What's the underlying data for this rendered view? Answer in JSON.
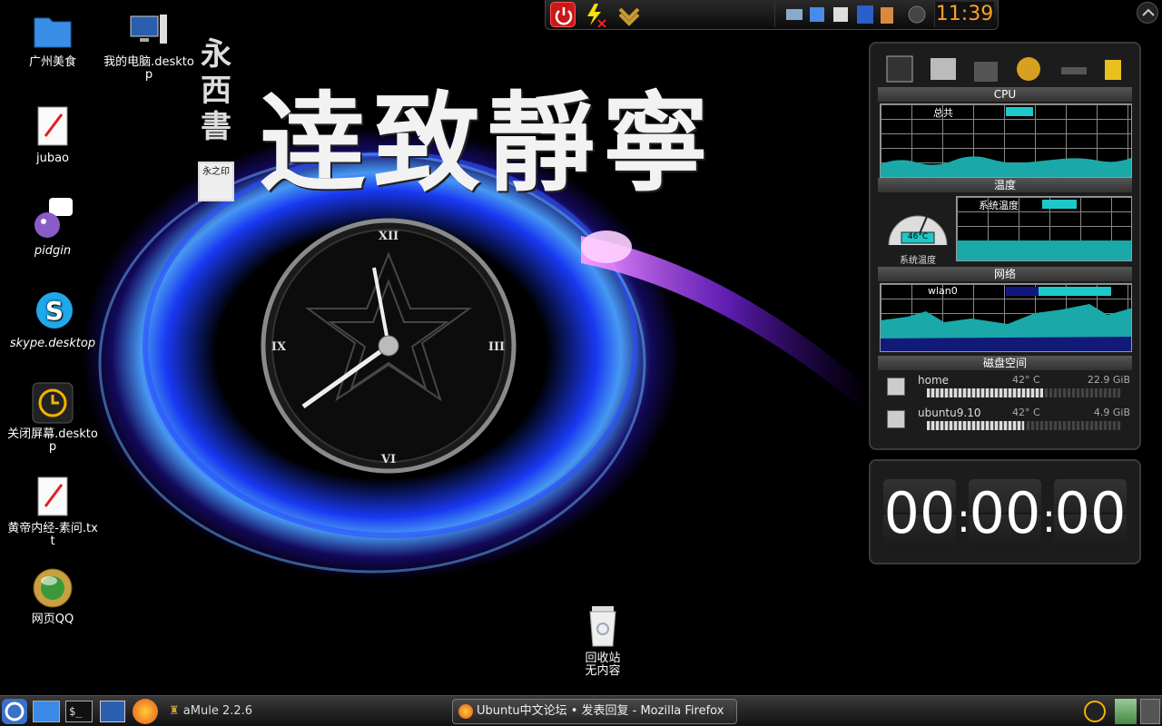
{
  "wallpaper": {
    "calligraphy": "逹致靜寧",
    "side_text": "永西書",
    "seal_text": "永之印"
  },
  "desktop_icons": [
    {
      "label": "广州美食",
      "italic": false
    },
    {
      "label": "我的电脑.desktop",
      "italic": false
    },
    {
      "label": "jubao",
      "italic": false
    },
    {
      "label": "pidgin",
      "italic": true
    },
    {
      "label": "skype.desktop",
      "italic": true
    },
    {
      "label": "关闭屏幕.desktop",
      "italic": false
    },
    {
      "label": "黄帝内经-素问.txt",
      "italic": false
    },
    {
      "label": "网页QQ",
      "italic": false
    }
  ],
  "trash": {
    "label": "回收站\n无内容"
  },
  "clock_widget": {
    "numerals": [
      "XII",
      "III",
      "VI",
      "IX"
    ]
  },
  "top_panel": {
    "time": "11:39"
  },
  "sysmon": {
    "cpu": {
      "title": "CPU",
      "label": "总共"
    },
    "temp": {
      "title": "温度",
      "label": "系统温度",
      "gauge_value": "46°C",
      "gauge_label": "系统温度"
    },
    "network": {
      "title": "网络",
      "label": "wlan0"
    },
    "disk": {
      "title": "磁盘空间",
      "rows": [
        {
          "name": "home",
          "temp": "42° C",
          "size": "22.9 GiB",
          "usage": 0.6
        },
        {
          "name": "ubuntu9.10",
          "temp": "42° C",
          "size": "4.9 GiB",
          "usage": 0.5
        }
      ]
    }
  },
  "timer": {
    "hours": "00",
    "minutes": "00",
    "seconds": "00",
    "sep": ":"
  },
  "taskbar": {
    "amule_label": "aMule 2.2.6",
    "firefox_task": "Ubuntu中文论坛 • 发表回复 - Mozilla Firefox"
  },
  "colors": {
    "accent": "#1ec8c8",
    "clock_orange": "#ff9d2e",
    "net_bar": "#101880"
  }
}
